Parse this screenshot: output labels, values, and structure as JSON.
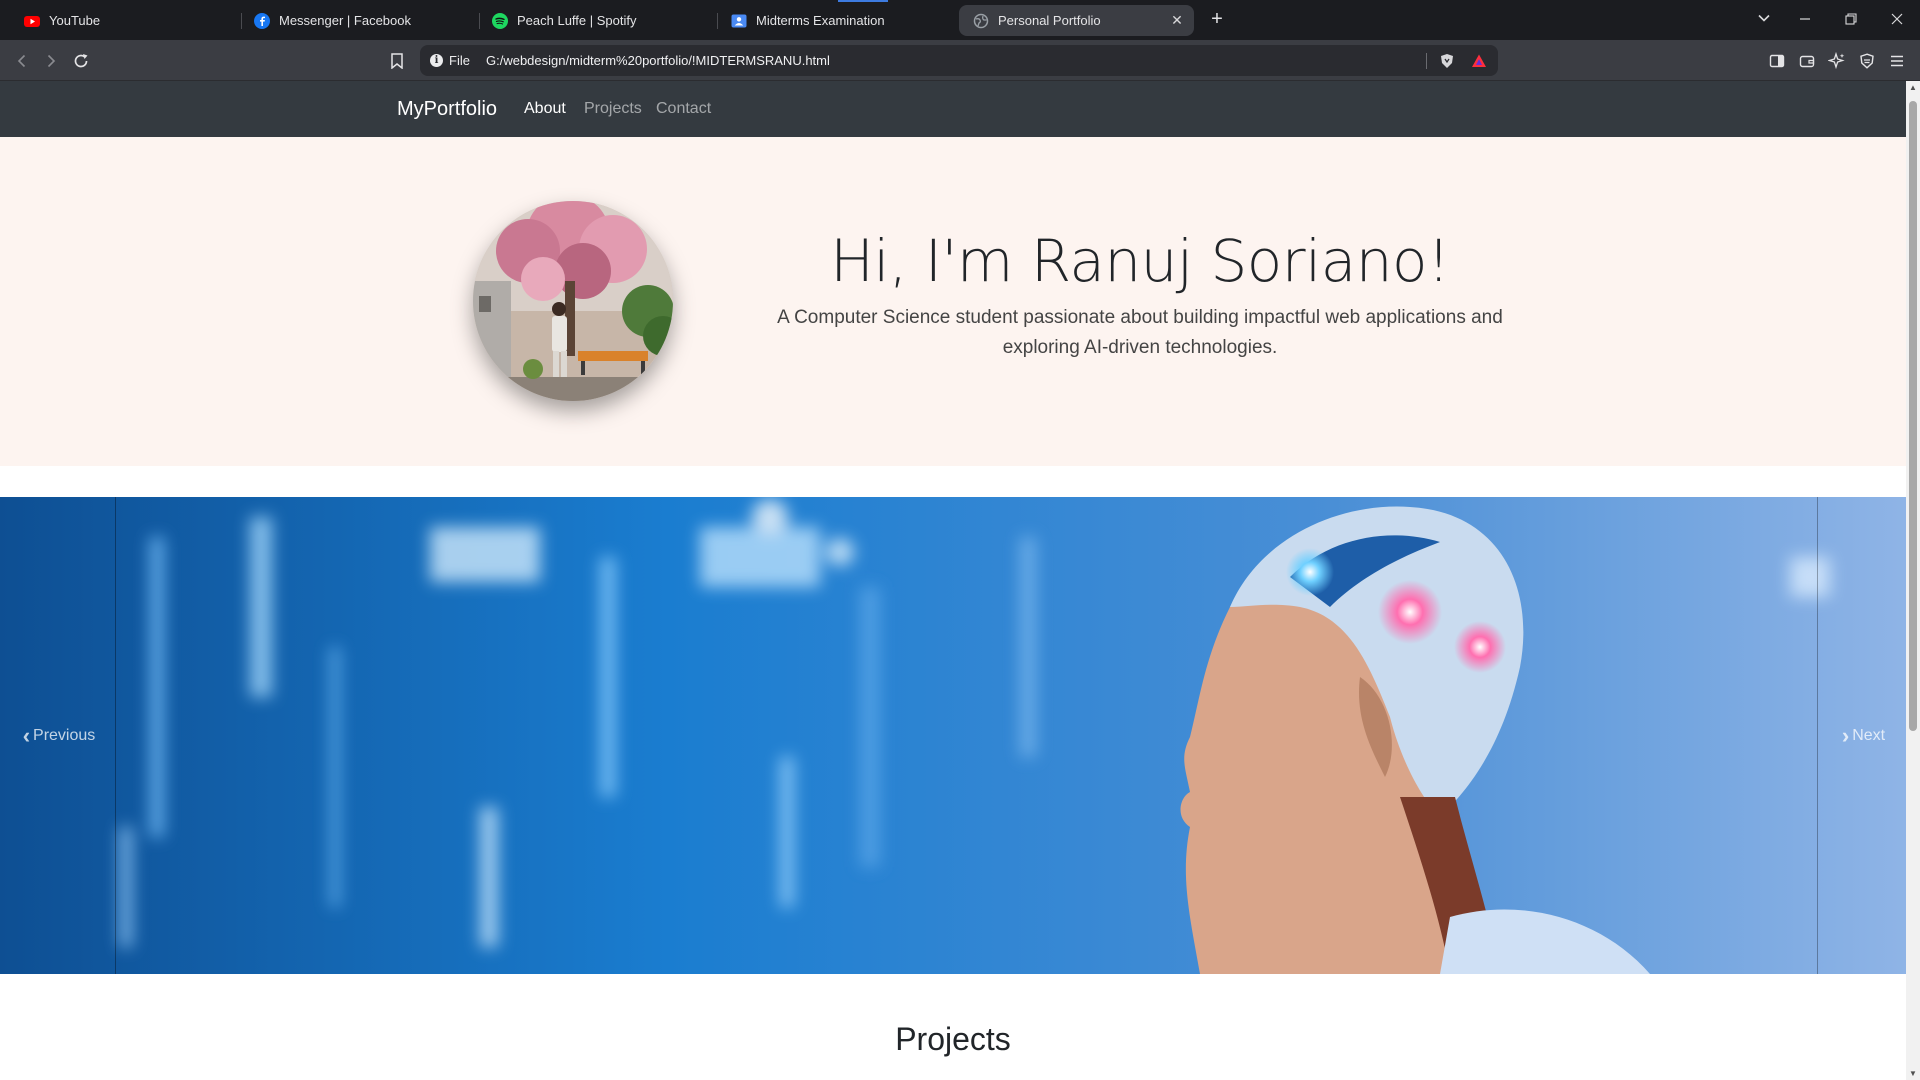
{
  "browser": {
    "tabs": [
      {
        "title": "YouTube",
        "icon": "youtube-icon"
      },
      {
        "title": "Messenger | Facebook",
        "icon": "facebook-icon"
      },
      {
        "title": "Peach Luffe | Spotify",
        "icon": "spotify-icon"
      },
      {
        "title": "Midterms Examination",
        "icon": "document-icon"
      },
      {
        "title": "Personal Portfolio",
        "icon": "globe-icon",
        "active": true
      }
    ],
    "site_info_label": "File",
    "url": "G:/webdesign/midterm%20portfolio/!MIDTERMSRANU.html",
    "colors": {
      "accent": "#3d7be0",
      "tabstrip": "#1b1c20",
      "toolbar": "#3b3d43"
    }
  },
  "page": {
    "navbar": {
      "brand": "MyPortfolio",
      "links": [
        "About",
        "Projects",
        "Contact"
      ],
      "active_link": "About",
      "bg": "#343a40"
    },
    "hero": {
      "title": "Hi, I'm Ranuj Soriano!",
      "subtitle": "A Computer Science student passionate about building impactful web applications and exploring AI-driven technologies.",
      "bg": "#fdf4f0"
    },
    "carousel": {
      "prev_label": "Previous",
      "next_label": "Next"
    },
    "projects_heading": "Projects"
  }
}
